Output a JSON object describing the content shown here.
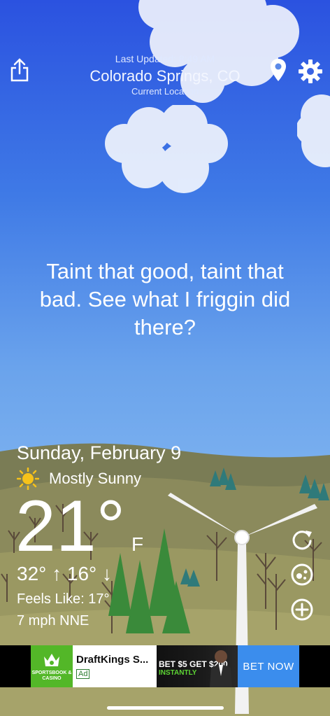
{
  "header": {
    "last_updated": "Last Updated: 8:49 AM",
    "city": "Colorado Springs, CO",
    "location_label": "Current Location"
  },
  "icons": {
    "share": "share-icon",
    "location": "location-pin-icon",
    "settings": "gear-icon",
    "refresh": "refresh-icon",
    "radar": "radar-icon",
    "add": "add-icon",
    "condition": "sun-icon"
  },
  "quote": "Taint that good, taint that bad. See what I friggin did there?",
  "weather": {
    "date": "Sunday, February 9",
    "condition": "Mostly Sunny",
    "temperature": "21°",
    "unit": "F",
    "high_low": "32° ↑  16° ↓",
    "feels_like": "Feels Like: 17°",
    "wind": "7 mph NNE"
  },
  "ad": {
    "logo_text": "SPORTSBOOK & CASINO",
    "title": "DraftKings S...",
    "badge": "Ad",
    "promo": "BET $5 GET $200",
    "promo_sub": "INSTANTLY",
    "cta": "BET NOW"
  },
  "colors": {
    "sky_top": "#2b52e0",
    "sky_bottom": "#7db2ef",
    "ground": "#8a8a5a",
    "ad_cta": "#3b8ded",
    "ad_logo": "#53b728"
  }
}
